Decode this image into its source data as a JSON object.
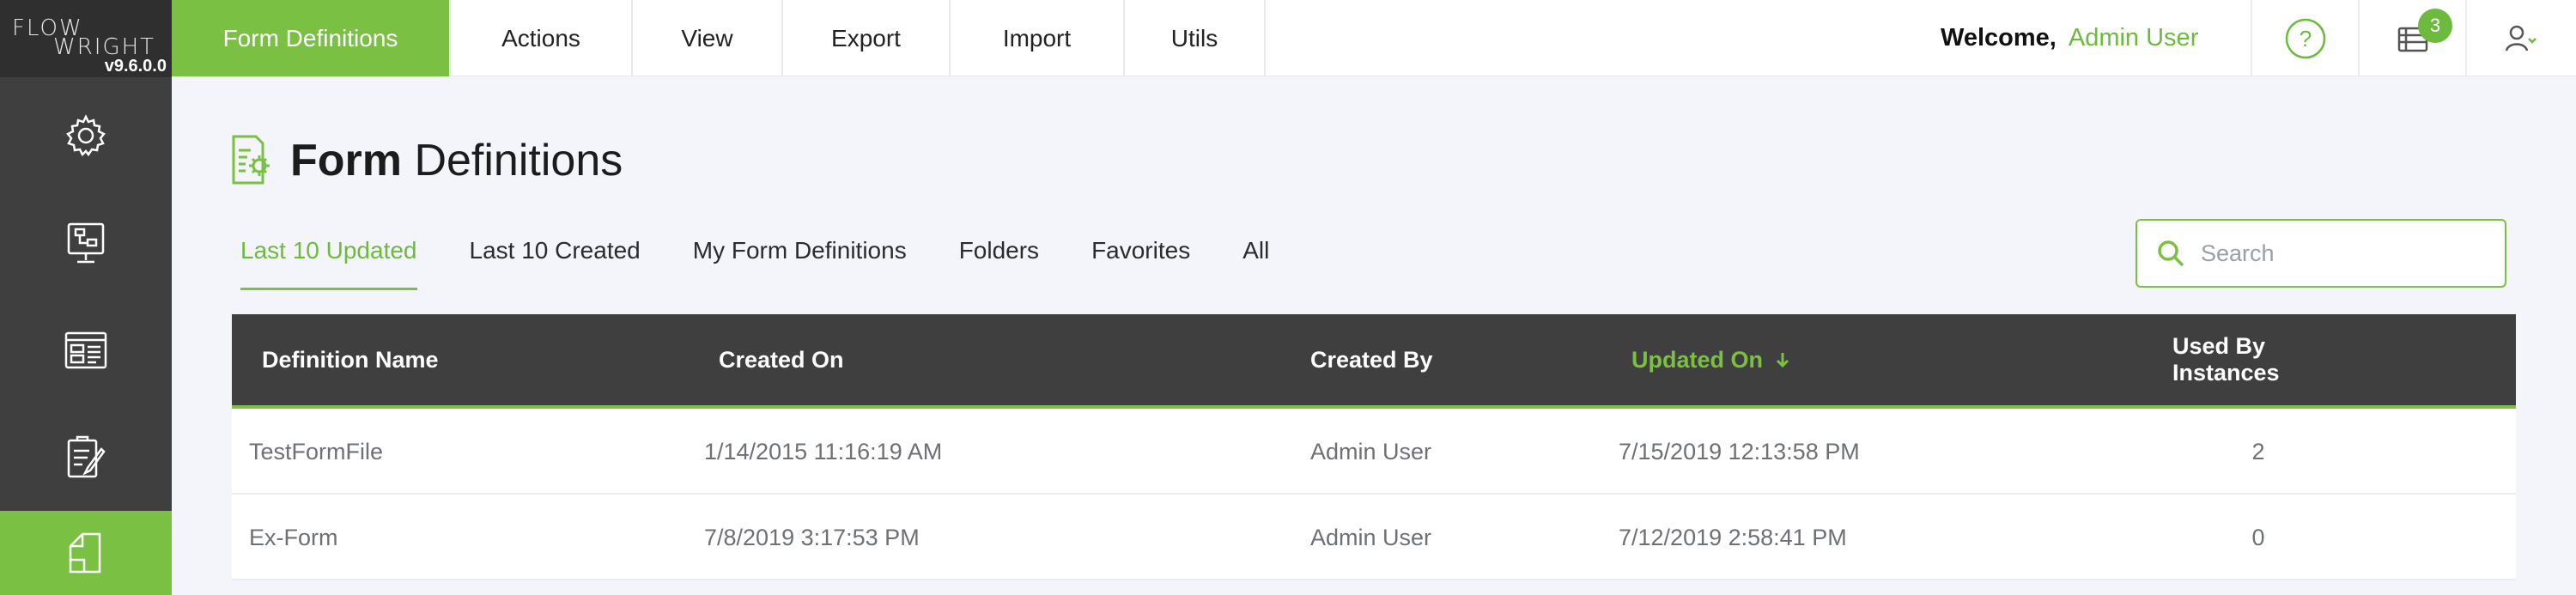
{
  "app": {
    "logo_line1": "FLOW",
    "logo_line2": "WRIGHT",
    "version": "v9.6.0.0"
  },
  "sidebar": {
    "items": [
      {
        "icon": "gear-settings-icon"
      },
      {
        "icon": "monitor-workflow-icon"
      },
      {
        "icon": "dashboard-window-icon"
      },
      {
        "icon": "form-edit-icon"
      },
      {
        "icon": "document-definitions-icon",
        "active": true
      }
    ]
  },
  "topmenu": {
    "items": [
      "Form Definitions",
      "Actions",
      "View",
      "Export",
      "Import",
      "Utils"
    ],
    "active": "Form Definitions"
  },
  "header": {
    "welcome_label": "Welcome,",
    "user_name": "Admin User",
    "notifications_count": "3",
    "help_icon": "question-circle-icon",
    "notifications_icon": "notification-stack-icon",
    "user_icon": "user-dropdown-icon"
  },
  "page": {
    "title_bold": "Form",
    "title_rest": "Definitions",
    "title_icon": "form-gear-icon"
  },
  "tabs": {
    "items": [
      "Last 10 Updated",
      "Last 10 Created",
      "My Form Definitions",
      "Folders",
      "Favorites",
      "All"
    ],
    "active": "Last 10 Updated"
  },
  "search": {
    "placeholder": "Search",
    "value": ""
  },
  "table": {
    "columns": [
      "Definition Name",
      "Created On",
      "Created By",
      "Updated On",
      "Used By Instances"
    ],
    "sorted_column": "Updated On",
    "sort_direction": "descending",
    "rows": [
      [
        "TestFormFile",
        "1/14/2015 11:16:19 AM",
        "Admin User",
        "7/15/2019 12:13:58 PM",
        "2"
      ],
      [
        "Ex-Form",
        "7/8/2019 3:17:53 PM",
        "Admin User",
        "7/12/2019 2:58:41 PM",
        "0"
      ]
    ]
  },
  "colors": {
    "accent": "#7ac143",
    "sidebar": "#3f3f3f",
    "table_header": "#3f3f3f"
  }
}
